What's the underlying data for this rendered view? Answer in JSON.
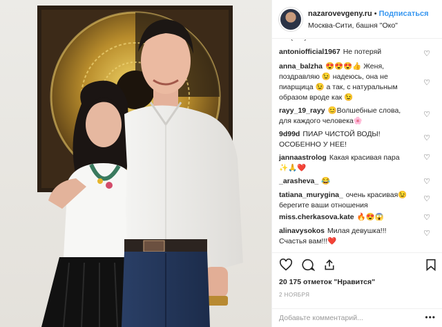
{
  "post": {
    "photo_alt": "couple-photo",
    "header": {
      "username": "nazarovevgeny.ru",
      "separator": "•",
      "follow_label": "Подписаться",
      "location": "Москва-Сити, башня \"Око\""
    },
    "comments": {
      "clipped_text": "......(......)... ...... .",
      "items": [
        {
          "user": "antoniofficial1967",
          "text": "Не потеряй"
        },
        {
          "user": "anna_balzha",
          "line1": "😍😍😍👍 Женя,",
          "line2": "поздравляю 😉 надеюсь, она не",
          "line3": "пиарщица 😉 а так, с натуральным",
          "line4": "образом вроде как 😉"
        },
        {
          "user": "rayy_19_rayy",
          "line1": "😊Волшебные слова,",
          "line2": "для каждого человека🌸"
        },
        {
          "user": "9d99d",
          "line1": "ПИАР ЧИСТОЙ ВОДЫ!",
          "line2": "ОСОБЕННО У НЕЕ!"
        },
        {
          "user": "jannaastrolog",
          "line1": "Какая красивая пара",
          "line2": "✨🙏❤️"
        },
        {
          "user": "_arasheva_",
          "text": "😂"
        },
        {
          "user": "tatiana_murygina_",
          "line1": "очень красивая😉",
          "line2": "берегите ваши отношения"
        },
        {
          "user": "miss.cherkasova.kate",
          "text": "🔥😍😱"
        },
        {
          "user": "alinavysokos",
          "line1": "Милая девушка!!!",
          "line2": "Счастья вам!!!❤️"
        }
      ],
      "heart_icon": "♡"
    },
    "actions": {
      "likes": "20 175 отметок \"Нравится\"",
      "date": "2 НОЯБРЯ"
    },
    "add_comment": {
      "placeholder": "Добавьте комментарий...",
      "more": "•••"
    },
    "colors": {
      "link_blue": "#3897f0",
      "text": "#262626",
      "border": "#efefef",
      "muted": "#999999"
    }
  }
}
